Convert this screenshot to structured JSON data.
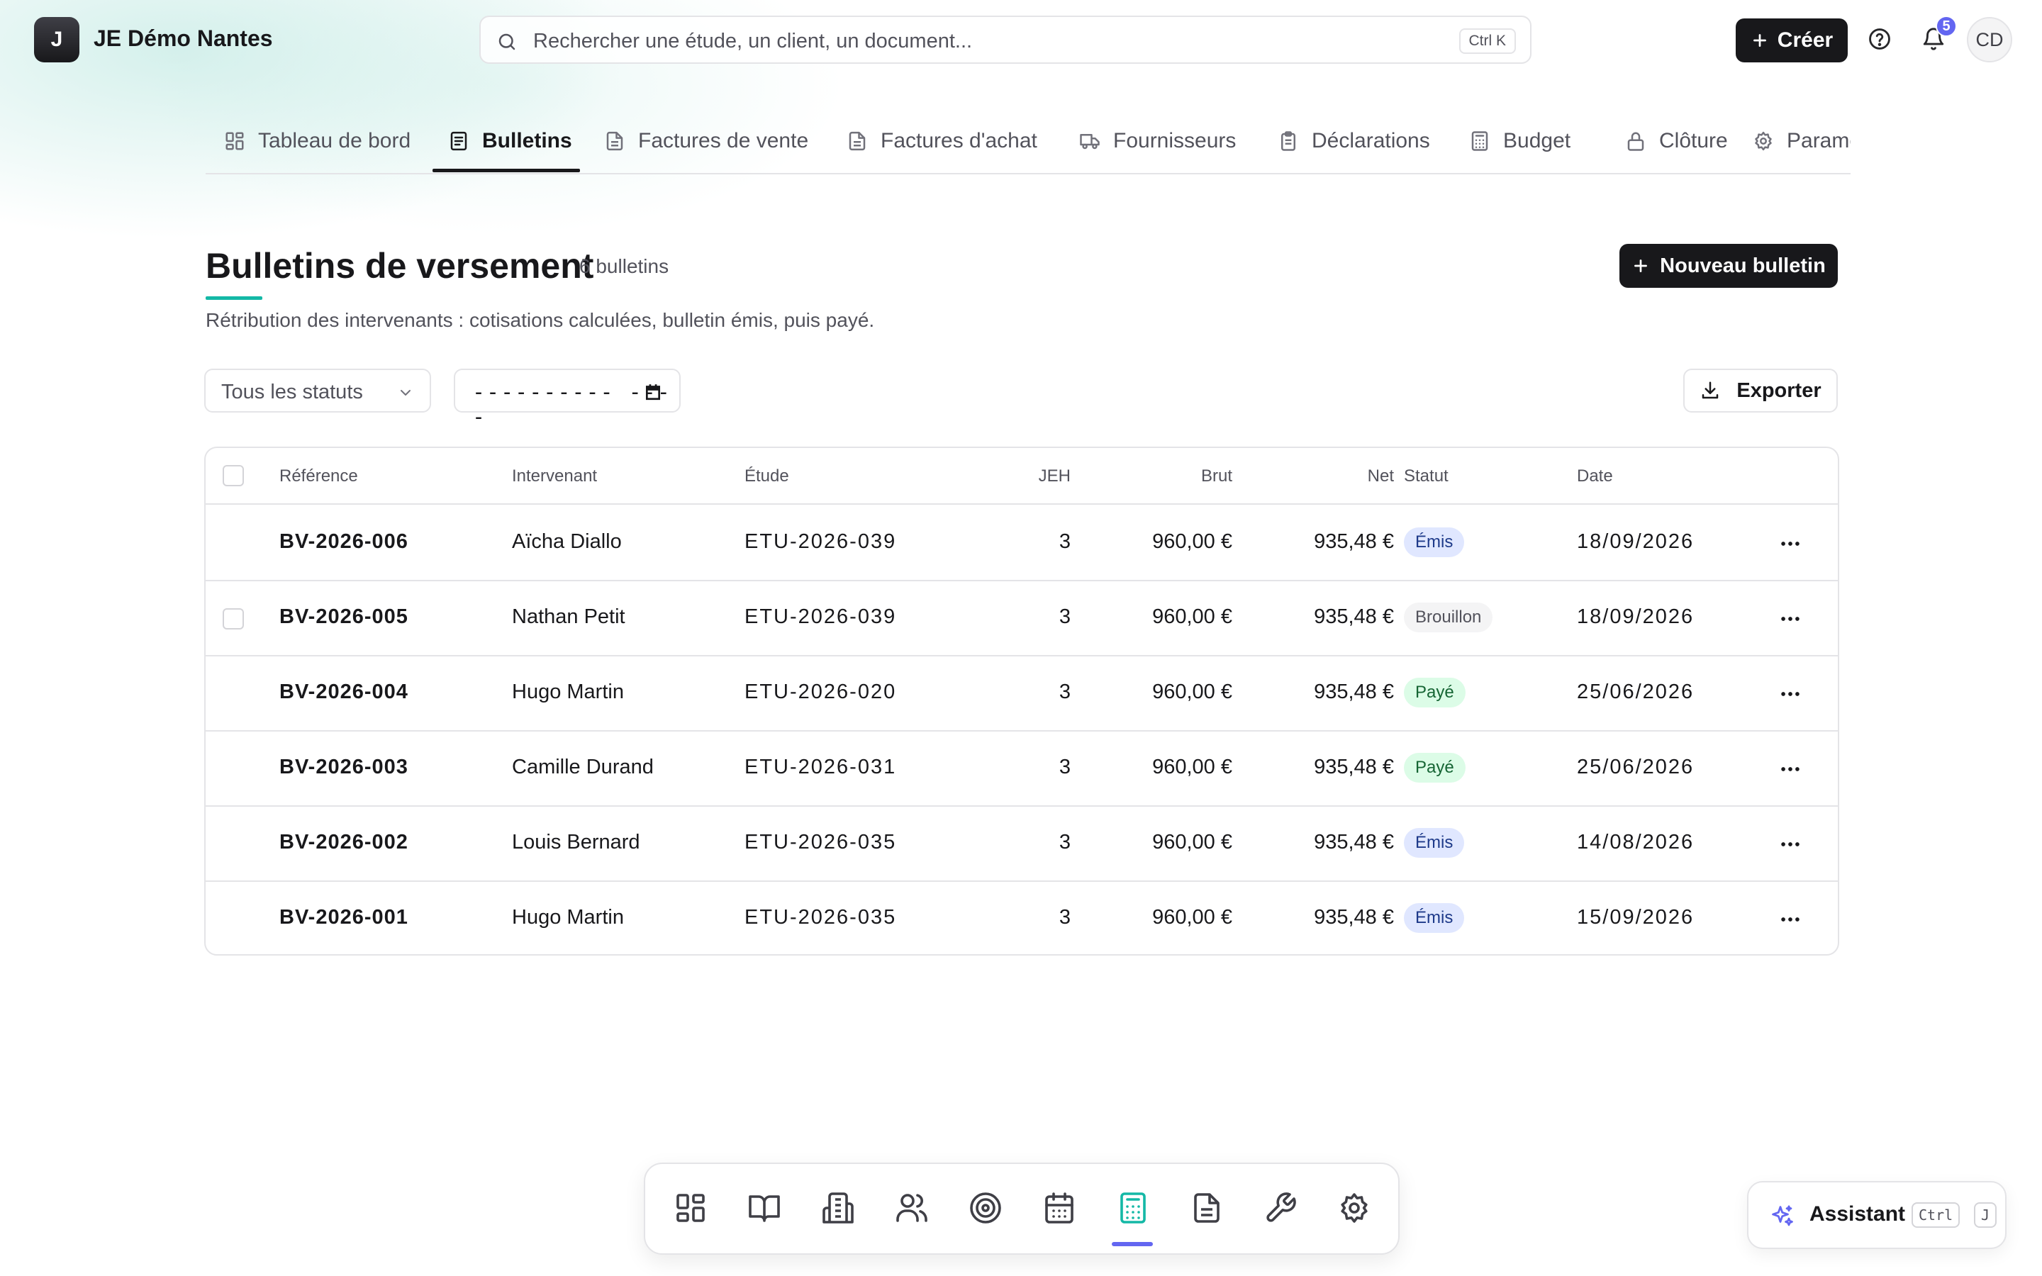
{
  "header": {
    "org_initial": "J",
    "org_name": "JE Démo Nantes",
    "search_placeholder": "Rechercher une étude, un client, un document...",
    "search_shortcut": "Ctrl K",
    "create_label": "Créer",
    "notifications_count": "5",
    "user_initials": "CD"
  },
  "tabs": [
    {
      "label": "Tableau de bord",
      "icon": "layout-grid-icon",
      "active": false
    },
    {
      "label": "Bulletins",
      "icon": "file-text-icon",
      "active": true
    },
    {
      "label": "Factures de vente",
      "icon": "file-icon",
      "active": false
    },
    {
      "label": "Factures d'achat",
      "icon": "file-icon",
      "active": false
    },
    {
      "label": "Fournisseurs",
      "icon": "truck-icon",
      "active": false
    },
    {
      "label": "Déclarations",
      "icon": "clipboard-icon",
      "active": false
    },
    {
      "label": "Budget",
      "icon": "calculator-icon",
      "active": false
    },
    {
      "label": "Clôture",
      "icon": "lock-icon",
      "active": false
    },
    {
      "label": "Paramètres",
      "icon": "gear-icon",
      "active": false
    }
  ],
  "page": {
    "title": "Bulletins de versement",
    "count": "6 bulletins",
    "subtitle": "Rétribution des intervenants : cotisations calculées, bulletin émis, puis payé.",
    "new_button": "Nouveau bulletin"
  },
  "filters": {
    "status_value": "Tous les statuts",
    "date_value": "---------- ----",
    "export_label": "Exporter"
  },
  "table": {
    "columns": [
      "Référence",
      "Intervenant",
      "Étude",
      "JEH",
      "Brut",
      "Net",
      "Statut",
      "Date"
    ],
    "rows": [
      {
        "ref": "BV-2026-006",
        "intervenant": "Aïcha Diallo",
        "etude": "ETU-2026-039",
        "jeh": "3",
        "brut": "960,00 €",
        "net": "935,48 €",
        "statut": "Émis",
        "statut_type": "emis",
        "date": "18/09/2026",
        "checkbox": false
      },
      {
        "ref": "BV-2026-005",
        "intervenant": "Nathan Petit",
        "etude": "ETU-2026-039",
        "jeh": "3",
        "brut": "960,00 €",
        "net": "935,48 €",
        "statut": "Brouillon",
        "statut_type": "brouillon",
        "date": "18/09/2026",
        "checkbox": true
      },
      {
        "ref": "BV-2026-004",
        "intervenant": "Hugo Martin",
        "etude": "ETU-2026-020",
        "jeh": "3",
        "brut": "960,00 €",
        "net": "935,48 €",
        "statut": "Payé",
        "statut_type": "paye",
        "date": "25/06/2026",
        "checkbox": false
      },
      {
        "ref": "BV-2026-003",
        "intervenant": "Camille Durand",
        "etude": "ETU-2026-031",
        "jeh": "3",
        "brut": "960,00 €",
        "net": "935,48 €",
        "statut": "Payé",
        "statut_type": "paye",
        "date": "25/06/2026",
        "checkbox": false
      },
      {
        "ref": "BV-2026-002",
        "intervenant": "Louis Bernard",
        "etude": "ETU-2026-035",
        "jeh": "3",
        "brut": "960,00 €",
        "net": "935,48 €",
        "statut": "Émis",
        "statut_type": "emis",
        "date": "14/08/2026",
        "checkbox": false
      },
      {
        "ref": "BV-2026-001",
        "intervenant": "Hugo Martin",
        "etude": "ETU-2026-035",
        "jeh": "3",
        "brut": "960,00 €",
        "net": "935,48 €",
        "statut": "Émis",
        "statut_type": "emis",
        "date": "15/09/2026",
        "checkbox": false
      }
    ]
  },
  "dock": {
    "items": [
      {
        "icon": "layout-grid-icon",
        "active": false
      },
      {
        "icon": "book-open-icon",
        "active": false
      },
      {
        "icon": "building-icon",
        "active": false
      },
      {
        "icon": "users-icon",
        "active": false
      },
      {
        "icon": "target-icon",
        "active": false
      },
      {
        "icon": "calendar-icon",
        "active": false
      },
      {
        "icon": "calculator-icon",
        "active": true
      },
      {
        "icon": "file-text-icon",
        "active": false
      },
      {
        "icon": "wrench-icon",
        "active": false
      },
      {
        "icon": "gear-icon",
        "active": false
      }
    ]
  },
  "assistant": {
    "label": "Assistant",
    "shortcut_1": "Ctrl",
    "shortcut_2": "J"
  },
  "colors": {
    "accent_teal": "#14b8a6",
    "accent_indigo": "#6366f1",
    "primary_dark": "#18181b"
  }
}
